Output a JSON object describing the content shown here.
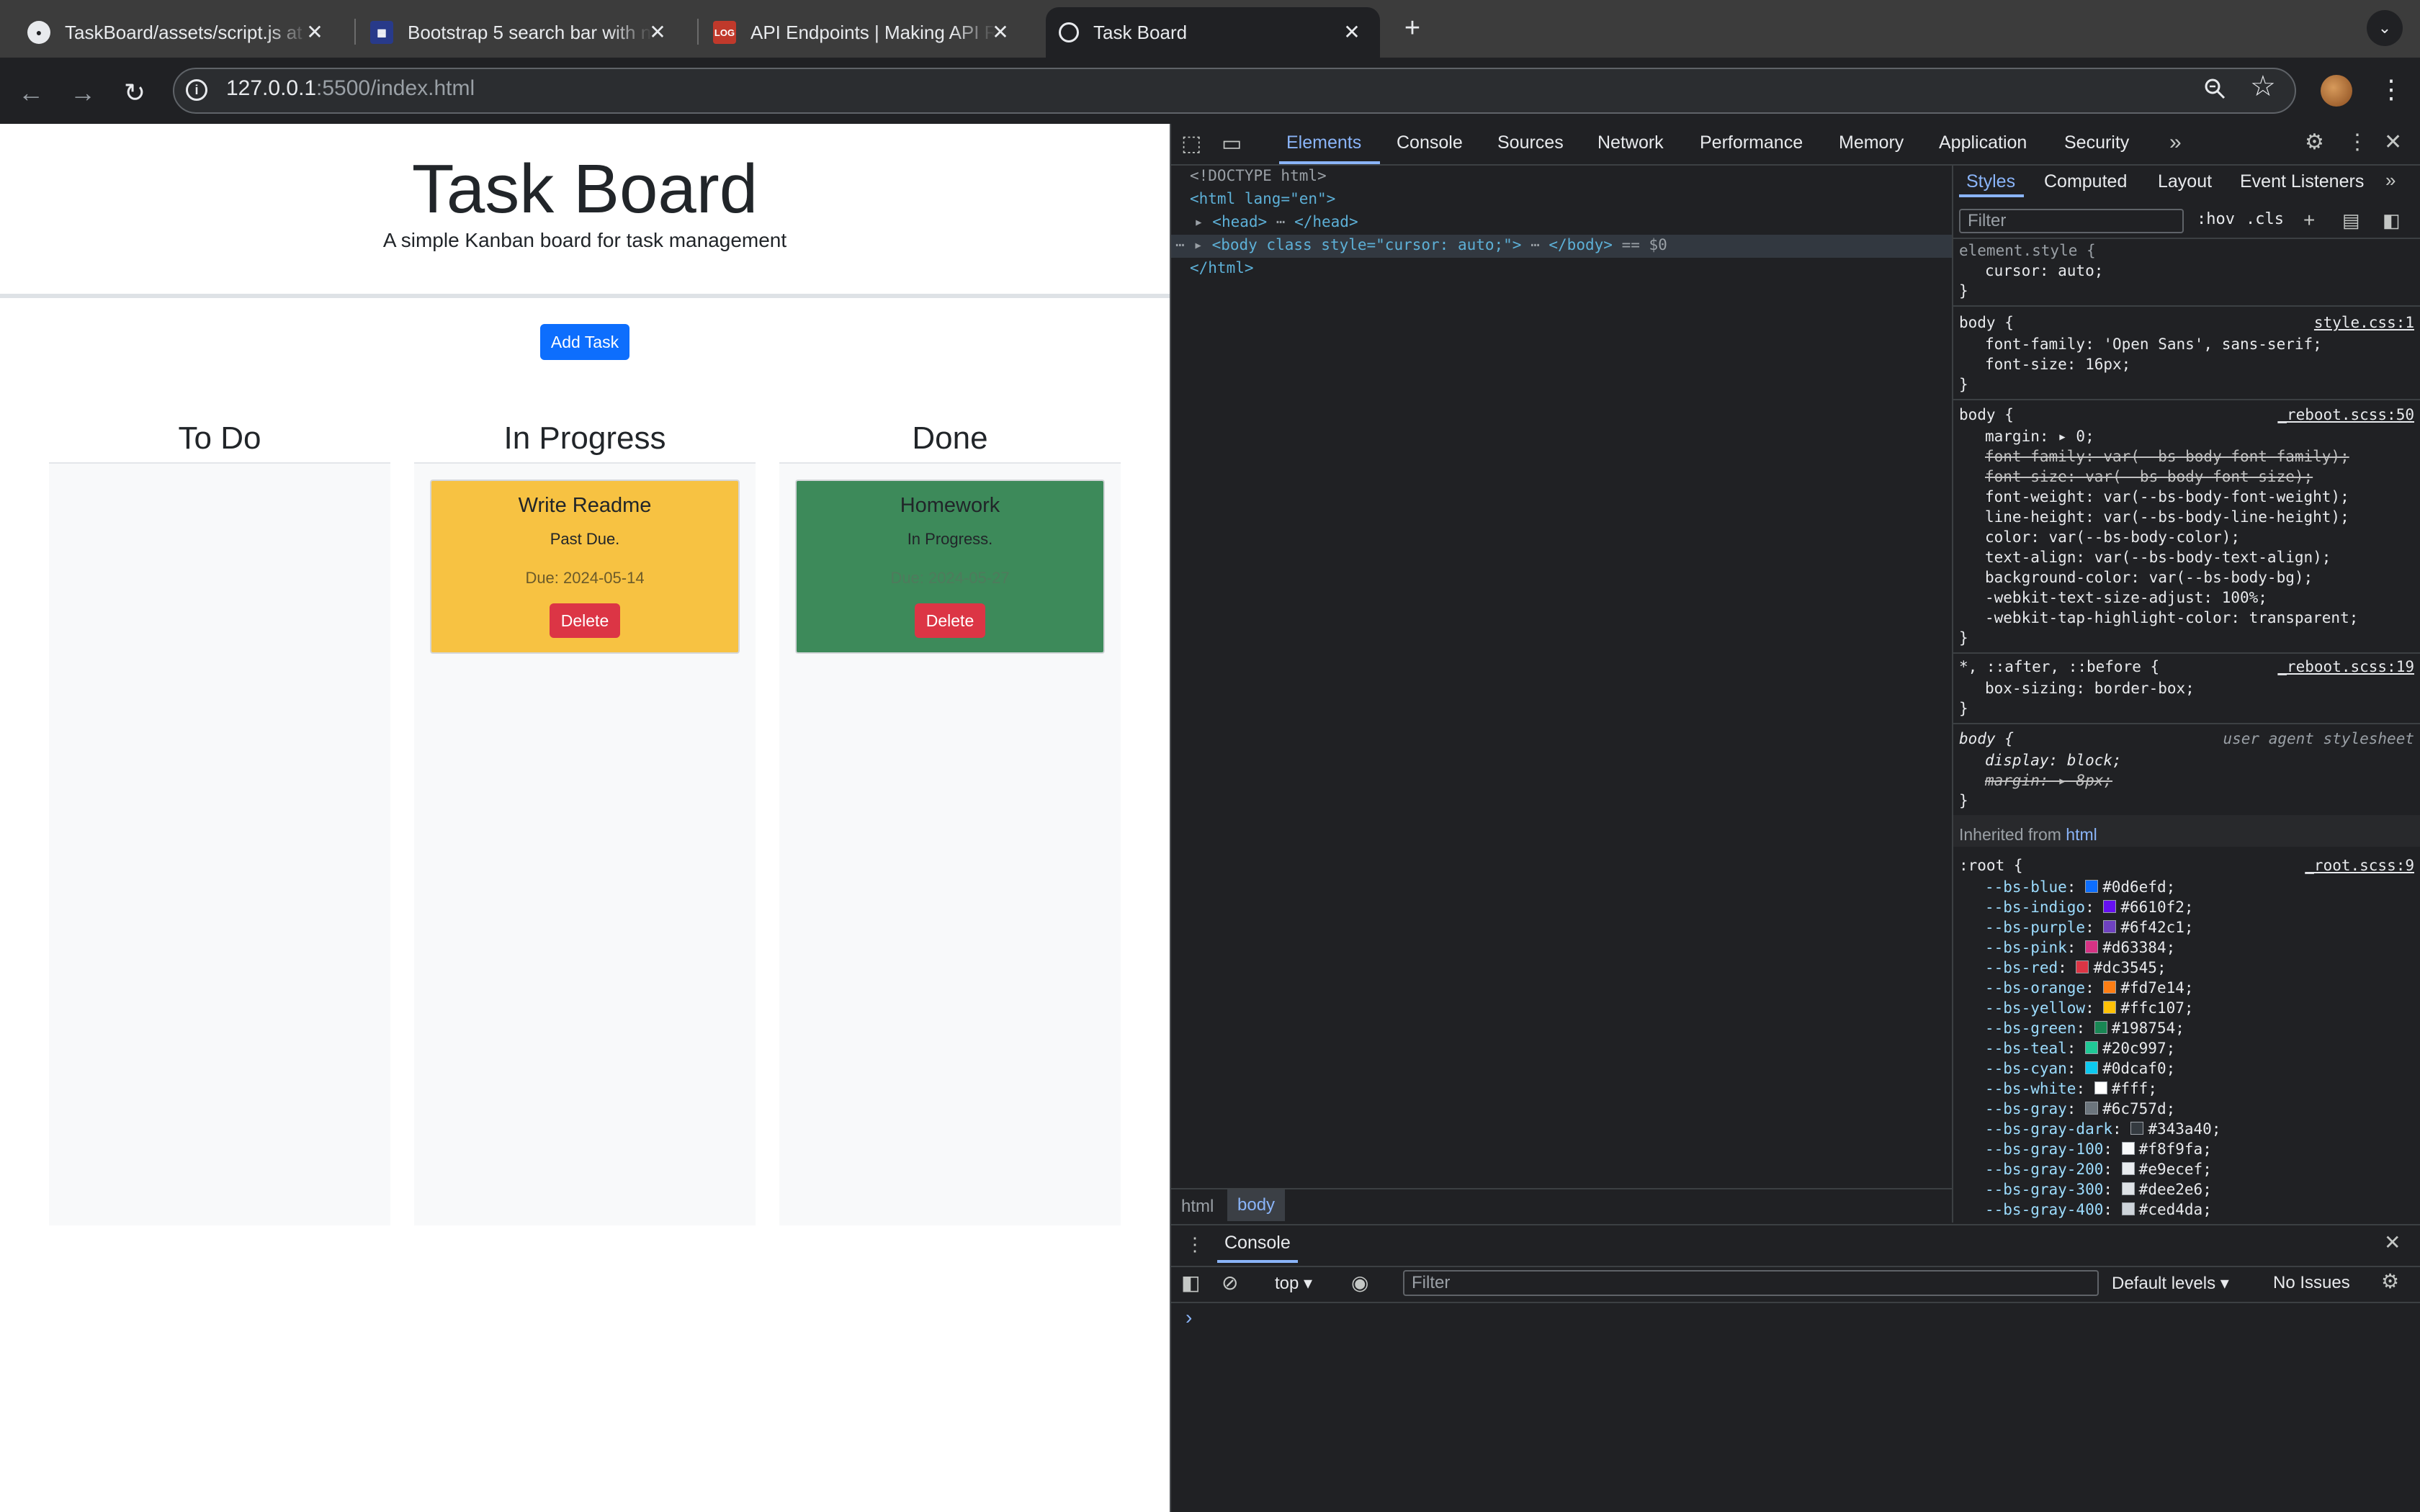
{
  "browser": {
    "tabs": [
      {
        "title": "TaskBoard/assets/script.js at",
        "favicon": "github-icon"
      },
      {
        "title": "Bootstrap 5 search bar with n",
        "favicon": "mdb-icon"
      },
      {
        "title": "API Endpoints | Making API R",
        "favicon": "log-icon",
        "favicon_text": "LOG"
      },
      {
        "title": "Task Board",
        "favicon": "globe-icon",
        "active": true
      }
    ],
    "new_tab": "+",
    "url_host": "127.0.0.1",
    "url_path": ":5500/index.html"
  },
  "page": {
    "title": "Task Board",
    "subtitle": "A simple Kanban board for task management",
    "add_task_label": "Add Task",
    "lanes": [
      {
        "name": "To Do",
        "cards": []
      },
      {
        "name": "In Progress",
        "cards": [
          {
            "title": "Write Readme",
            "description": "Past Due.",
            "due": "Due: 2024-05-14",
            "delete_label": "Delete",
            "color": "#f7c242"
          }
        ]
      },
      {
        "name": "Done",
        "cards": [
          {
            "title": "Homework",
            "description": "In Progress.",
            "due": "Due: 2024-05-27",
            "delete_label": "Delete",
            "color": "#3d8a5a"
          }
        ]
      }
    ]
  },
  "devtools": {
    "tabs": [
      "Elements",
      "Console",
      "Sources",
      "Network",
      "Performance",
      "Memory",
      "Application",
      "Security"
    ],
    "active_tab": "Elements",
    "dom": {
      "doctype": "<!DOCTYPE html>",
      "html_open": "<html lang=\"en\">",
      "head": "<head>",
      "head_close": "</head>",
      "body_open": "<body class style=\"cursor: auto;\">",
      "body_close": "</body>",
      "body_suffix": "== $0",
      "html_close": "</html>"
    },
    "breadcrumbs": [
      "html",
      "body"
    ],
    "styles_tabs": [
      "Styles",
      "Computed",
      "Layout",
      "Event Listeners"
    ],
    "styles_filter_placeholder": "Filter",
    "hov": ":hov",
    "cls": ".cls",
    "rules": {
      "element_style": {
        "selector": "element.style {",
        "props": [
          "cursor: auto;"
        ]
      },
      "body1": {
        "selector": "body {",
        "source": "style.css:1",
        "props": [
          "font-family: 'Open Sans', sans-serif;",
          "font-size: 16px;"
        ]
      },
      "body2": {
        "selector": "body {",
        "source": "_reboot.scss:50",
        "props": [
          "margin: ▸ 0;",
          "font-family: var(--bs-body-font-family);",
          "font-size: var(--bs-body-font-size);",
          "font-weight: var(--bs-body-font-weight);",
          "line-height: var(--bs-body-line-height);",
          "color: var(--bs-body-color);",
          "text-align: var(--bs-body-text-align);",
          "background-color: var(--bs-body-bg);",
          "-webkit-text-size-adjust: 100%;",
          "-webkit-tap-highlight-color: transparent;"
        ]
      },
      "universal": {
        "selector": "*, ::after, ::before {",
        "source": "_reboot.scss:19",
        "props": [
          "box-sizing: border-box;"
        ]
      },
      "ua_body": {
        "selector": "body {",
        "source": "user agent stylesheet",
        "props": [
          "display: block;",
          "margin: ▸ 8px;"
        ]
      },
      "inherited_label": "Inherited from",
      "inherited_from": "html",
      "root": {
        "selector": ":root {",
        "source": "_root.scss:9",
        "vars": [
          {
            "name": "--bs-blue",
            "value": "#0d6efd"
          },
          {
            "name": "--bs-indigo",
            "value": "#6610f2"
          },
          {
            "name": "--bs-purple",
            "value": "#6f42c1"
          },
          {
            "name": "--bs-pink",
            "value": "#d63384"
          },
          {
            "name": "--bs-red",
            "value": "#dc3545"
          },
          {
            "name": "--bs-orange",
            "value": "#fd7e14"
          },
          {
            "name": "--bs-yellow",
            "value": "#ffc107"
          },
          {
            "name": "--bs-green",
            "value": "#198754"
          },
          {
            "name": "--bs-teal",
            "value": "#20c997"
          },
          {
            "name": "--bs-cyan",
            "value": "#0dcaf0"
          },
          {
            "name": "--bs-white",
            "value": "#fff"
          },
          {
            "name": "--bs-gray",
            "value": "#6c757d"
          },
          {
            "name": "--bs-gray-dark",
            "value": "#343a40"
          },
          {
            "name": "--bs-gray-100",
            "value": "#f8f9fa"
          },
          {
            "name": "--bs-gray-200",
            "value": "#e9ecef"
          },
          {
            "name": "--bs-gray-300",
            "value": "#dee2e6"
          },
          {
            "name": "--bs-gray-400",
            "value": "#ced4da"
          }
        ]
      }
    },
    "console": {
      "label": "Console",
      "context": "top",
      "filter_placeholder": "Filter",
      "levels": "Default levels",
      "issues": "No Issues",
      "prompt": "›"
    }
  }
}
